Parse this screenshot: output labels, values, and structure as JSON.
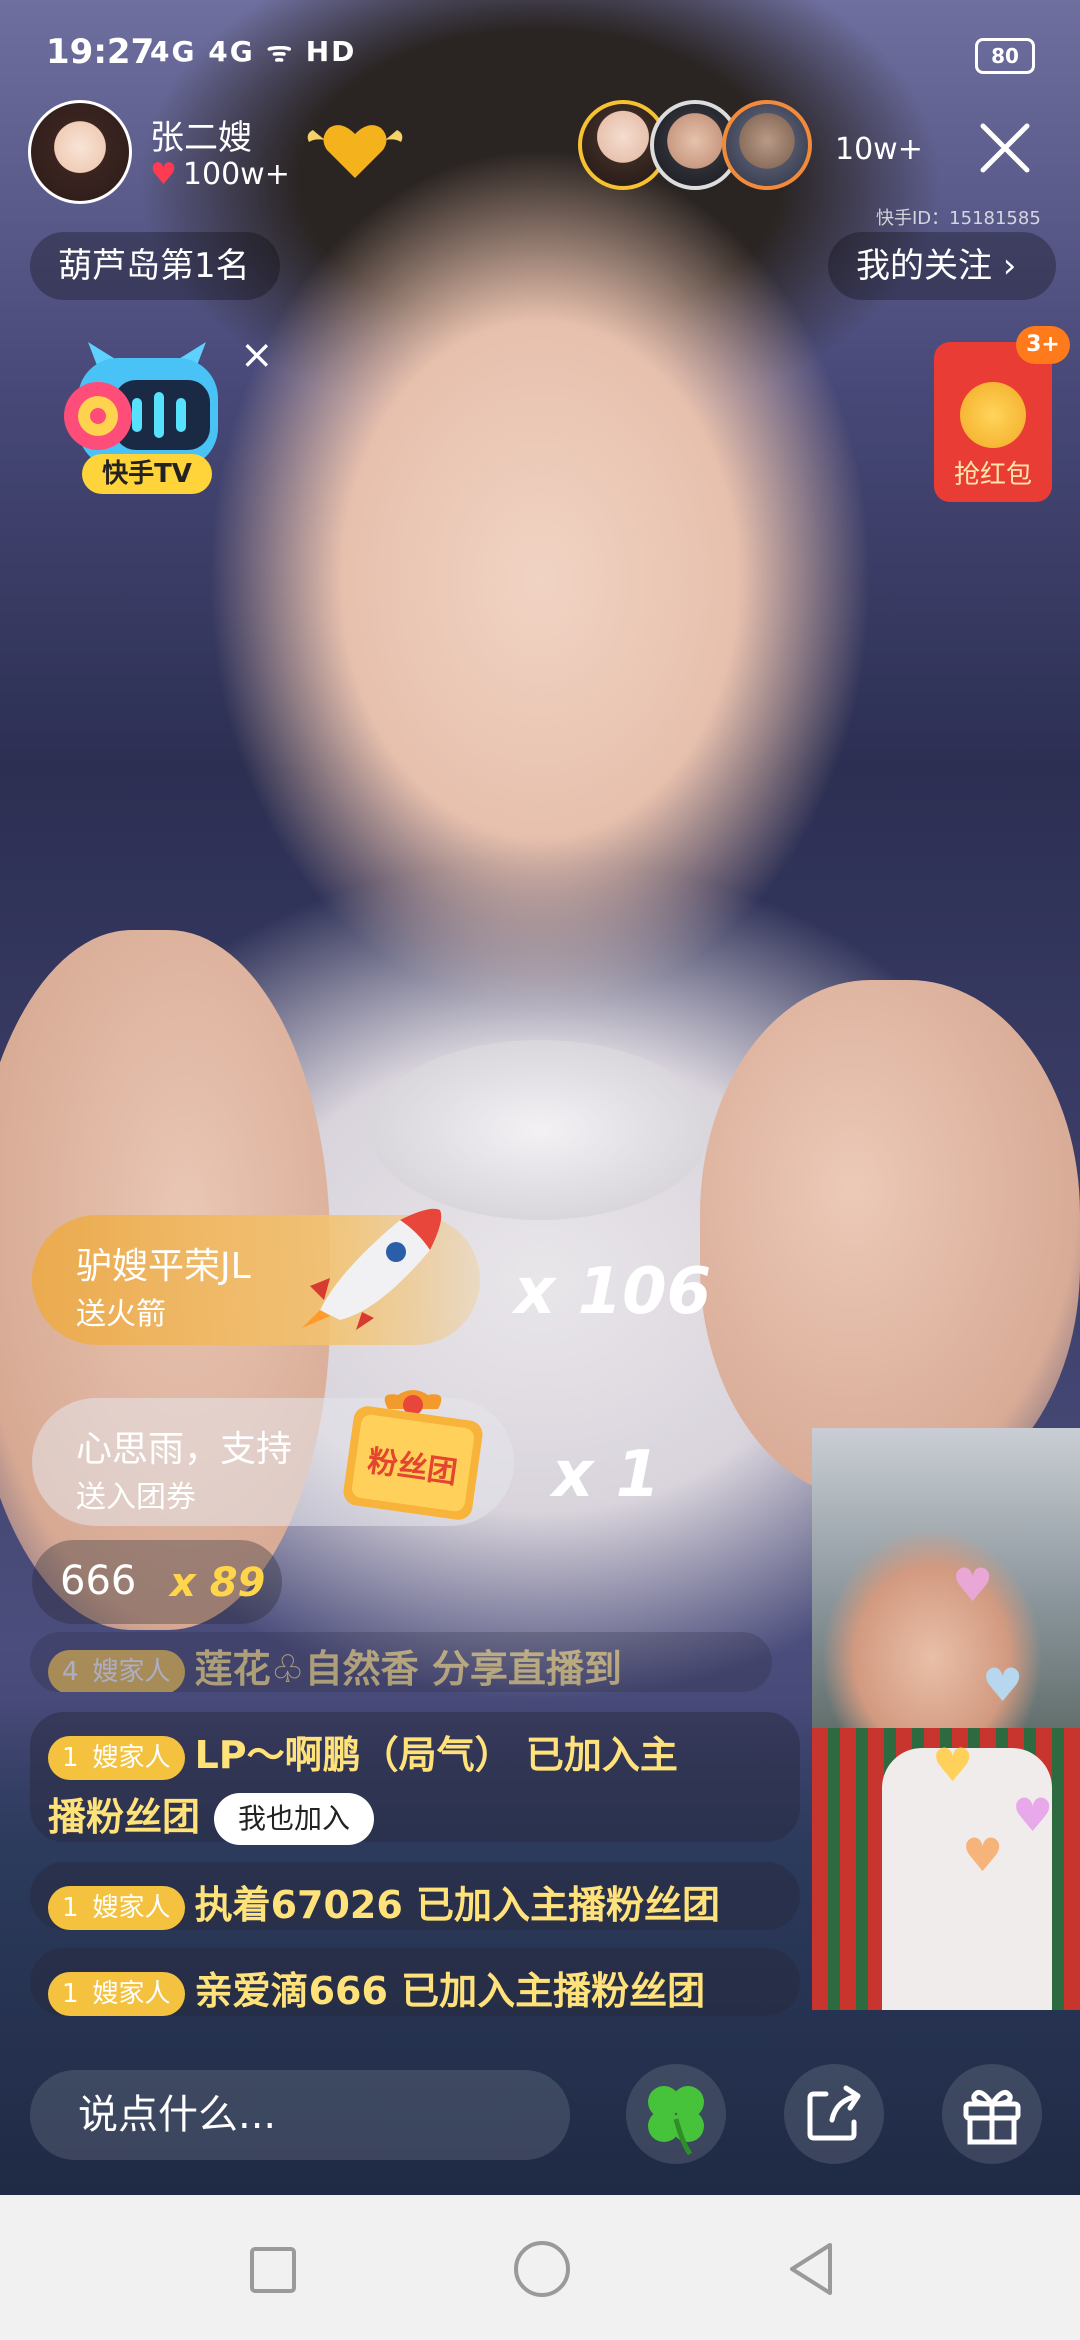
{
  "status_bar": {
    "time": "19:27",
    "signal": "4G 4G",
    "network": "HD",
    "battery": "80"
  },
  "host": {
    "name": "张二嫂",
    "likes": "100w+"
  },
  "viewers": {
    "count": "10w+"
  },
  "kuaishou_id": "快手ID：15181585",
  "rank_pill": "葫芦岛第1名",
  "follow_pill": "我的关注 ›",
  "ktv_label": "快手TV",
  "red_packet": {
    "label": "抢红包",
    "badge": "3+"
  },
  "gifts": [
    {
      "sender": "驴嫂平荣JL",
      "action": "送火箭",
      "multiplier": "x 106"
    },
    {
      "sender": "心思雨，支持",
      "action": "送入团券",
      "badge_text": "粉丝团",
      "multiplier": "x 1"
    }
  ],
  "combo": {
    "text": "666",
    "multiplier": "x 89"
  },
  "chat": [
    {
      "level": "4",
      "tag": "嫂家人",
      "text": "莲花♧自然香 分享直播到"
    },
    {
      "level": "1",
      "tag": "嫂家人",
      "text_line1": "LP～啊鹏（局气） 已加入主",
      "text_line2": "播粉丝团",
      "button": "我也加入"
    },
    {
      "level": "1",
      "tag": "嫂家人",
      "text": "执着67026 已加入主播粉丝团"
    },
    {
      "level": "1",
      "tag": "嫂家人",
      "text": "亲爱滴666 已加入主播粉丝团"
    }
  ],
  "input": {
    "placeholder": "说点什么..."
  },
  "colors": {
    "gift_orange": "#ECAA4A",
    "fan_badge": "#F4C23E",
    "chat_yellow": "#FFE27A",
    "red_packet": "#E93C35"
  }
}
